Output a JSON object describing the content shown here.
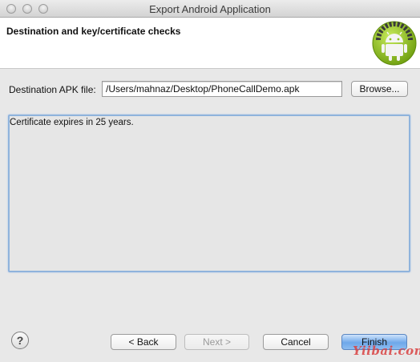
{
  "window": {
    "title": "Export Android Application"
  },
  "header": {
    "title": "Destination and key/certificate checks"
  },
  "destination": {
    "label": "Destination APK file:",
    "value": "/Users/mahnaz/Desktop/PhoneCallDemo.apk",
    "browse_label": "Browse..."
  },
  "message": {
    "text": "Certificate expires in 25 years."
  },
  "footer": {
    "help_glyph": "?",
    "back_label": "< Back",
    "next_label": "Next >",
    "cancel_label": "Cancel",
    "finish_label": "Finish"
  },
  "watermark": {
    "text": "Yiibai.com"
  },
  "colors": {
    "accent": "#6ea8ea",
    "android_green": "#8fc11a"
  },
  "icons": {
    "logo": "android-logo-icon",
    "help": "help-icon"
  }
}
